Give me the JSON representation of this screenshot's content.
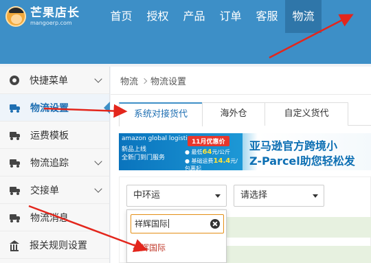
{
  "logo": {
    "name": "芒果店长",
    "domain": "mangoerp.com"
  },
  "nav": [
    {
      "label": "首页",
      "active": false
    },
    {
      "label": "授权",
      "active": false
    },
    {
      "label": "产品",
      "active": false
    },
    {
      "label": "订单",
      "active": false
    },
    {
      "label": "客服",
      "active": false
    },
    {
      "label": "物流",
      "active": true
    }
  ],
  "sidebar": {
    "items": [
      {
        "label": "快捷菜单",
        "icon": "gear-icon",
        "has_arrow": true,
        "active": false
      },
      {
        "label": "物流设置",
        "icon": "truck-icon",
        "has_arrow": false,
        "active": true
      },
      {
        "label": "运费模板",
        "icon": "truck-icon",
        "has_arrow": false,
        "active": false
      },
      {
        "label": "物流追踪",
        "icon": "truck-icon",
        "has_arrow": true,
        "active": false
      },
      {
        "label": "交接单",
        "icon": "truck-icon",
        "has_arrow": true,
        "active": false
      },
      {
        "label": "物流消息",
        "icon": "truck-icon",
        "has_arrow": false,
        "active": false
      },
      {
        "label": "报关规则设置",
        "icon": "bank-icon",
        "has_arrow": false,
        "active": false
      }
    ]
  },
  "breadcrumb": [
    "物流",
    "物流设置"
  ],
  "tabs": [
    {
      "label": "系统对接货代",
      "active": true
    },
    {
      "label": "海外仓",
      "active": false
    },
    {
      "label": "自定义货代",
      "active": false
    }
  ],
  "banner": {
    "brand": "amazon global logistics",
    "line1": "新品上线",
    "line2": "全新门到门服务",
    "tag": "11月优惠价",
    "price1_prefix": "● 最低",
    "price1_value": "64",
    "price1_suffix": "元/公斤",
    "price2_prefix": "● 基础运费",
    "price2_value": "14.4",
    "price2_suffix": "元/包裹起",
    "headline1": "亚马逊官方跨境小",
    "headline2": "Z-Parcel助您轻松发"
  },
  "filter": {
    "carrier_select": "中环运",
    "second_select": "请选择",
    "search_value": "祥辉国际",
    "option": "祥辉国际"
  },
  "colors": {
    "header": "#3d8fc7",
    "active_text": "#1f6fb2",
    "annotation": "#e3261c",
    "search_border": "#e38d13"
  }
}
